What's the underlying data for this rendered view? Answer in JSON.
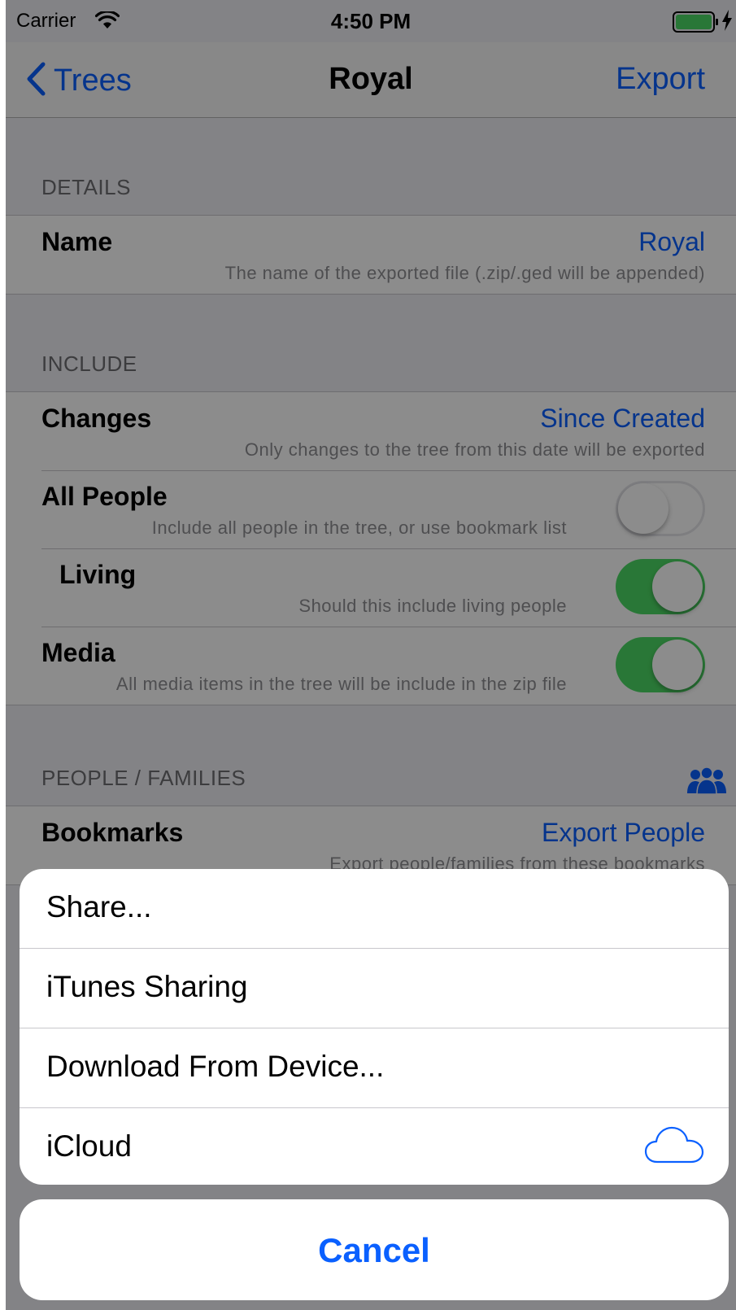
{
  "status_bar": {
    "carrier": "Carrier",
    "time": "4:50 PM"
  },
  "nav": {
    "back_label": "Trees",
    "title": "Royal",
    "export_label": "Export"
  },
  "details": {
    "header": "DETAILS",
    "name": {
      "title": "Name",
      "value": "Royal",
      "subtitle": "The name of the exported file (.zip/.ged will be appended)"
    }
  },
  "include": {
    "header": "INCLUDE",
    "changes": {
      "title": "Changes",
      "value": "Since Created",
      "subtitle": "Only changes to the tree from this date will be exported"
    },
    "all_people": {
      "title": "All People",
      "subtitle": "Include all people in the tree, or use bookmark list",
      "toggle_on": false
    },
    "living": {
      "title": "Living",
      "subtitle": "Should this include living people",
      "toggle_on": true
    },
    "media": {
      "title": "Media",
      "subtitle": "All media items in the tree will be include in the zip file",
      "toggle_on": true
    }
  },
  "people_families": {
    "header": "PEOPLE / FAMILIES",
    "bookmarks": {
      "title": "Bookmarks",
      "value": "Export People",
      "subtitle": "Export people/families from these bookmarks"
    }
  },
  "action_sheet": {
    "items": [
      {
        "label": "Share...",
        "icon": null
      },
      {
        "label": "iTunes Sharing",
        "icon": null
      },
      {
        "label": "Download From Device...",
        "icon": null
      },
      {
        "label": "iCloud",
        "icon": "cloud-icon"
      }
    ],
    "cancel_label": "Cancel"
  },
  "colors": {
    "accent": "#0a60ff",
    "toggle_on": "#4cd964",
    "background": "#efeff4"
  }
}
